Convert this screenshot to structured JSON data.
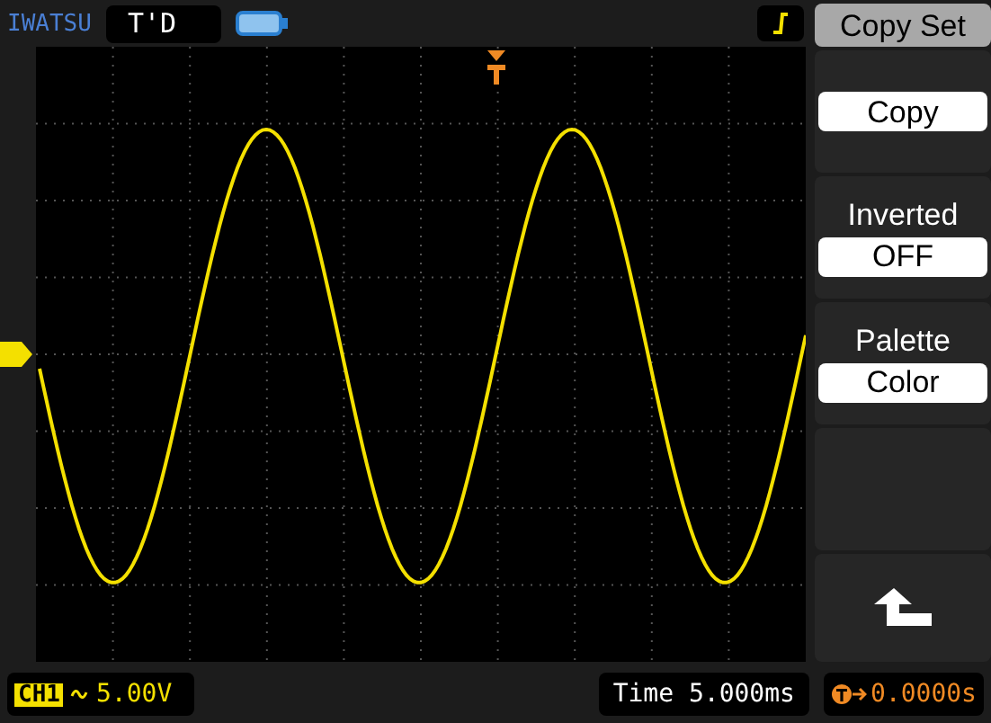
{
  "header": {
    "brand": "IWATSU",
    "mode": "T'D"
  },
  "menu": {
    "title": "Copy Set",
    "items": [
      {
        "kind": "button",
        "value": "Copy"
      },
      {
        "kind": "option",
        "label": "Inverted",
        "value": "OFF"
      },
      {
        "kind": "option",
        "label": "Palette",
        "value": "Color"
      },
      {
        "kind": "empty"
      },
      {
        "kind": "back"
      }
    ]
  },
  "status_bar": {
    "channel": "CH1",
    "volts": "5.00V",
    "timebase": "Time 5.000ms",
    "trigger_offset": "0.0000s"
  }
}
